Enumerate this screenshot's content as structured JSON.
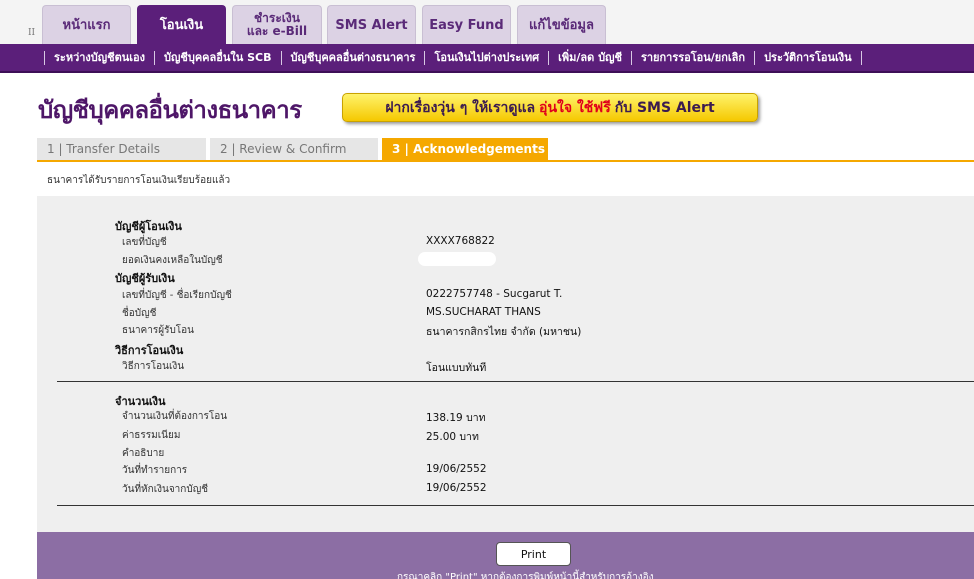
{
  "top_tabs": [
    {
      "label": "หน้าแรก",
      "active": false
    },
    {
      "label": "โอนเงิน",
      "active": true
    },
    {
      "label_line1": "ชำระเงิน",
      "label_line2": "และ e-Bill",
      "active": false
    },
    {
      "label": "SMS Alert",
      "active": false
    },
    {
      "label": "Easy Fund",
      "active": false
    },
    {
      "label": "แก้ไขข้อมูล",
      "active": false
    }
  ],
  "pipe_glyph": "II",
  "subnav": [
    "ระหว่างบัญชีตนเอง",
    "บัญชีบุคคลอื่นใน SCB",
    "บัญชีบุคคลอื่นต่างธนาคาร",
    "โอนเงินไปต่างประเทศ",
    "เพิ่ม/ลด บัญชี",
    "รายการรอโอน/ยกเลิก",
    "ประวัติการโอนเงิน"
  ],
  "page_title": "บัญชีบุคคลอื่นต่างธนาคาร",
  "banner": {
    "part1": "ฝากเรื่องวุ่น ๆ ให้เราดูแล",
    "highlight": "อุ่นใจ ใช้ฟรี",
    "part2": "กับ SMS Alert"
  },
  "steps": [
    "1 | Transfer Details",
    "2 | Review & Confirm",
    "3 | Acknowledgements"
  ],
  "ack_message": "ธนาคารได้รับรายการโอนเงินเรียบร้อยแล้ว",
  "details": {
    "from_header": "บัญชีผู้โอนเงิน",
    "from_account_label": "เลขที่บัญชี",
    "from_account_value": "XXXX768822",
    "balance_label": "ยอดเงินคงเหลือในบัญชี",
    "to_header": "บัญชีผู้รับเงิน",
    "to_account_label": "เลขที่บัญชี - ชื่อเรียกบัญชี",
    "to_account_value": "0222757748 - Sucgarut T.",
    "account_name_label": "ชื่อบัญชี",
    "account_name_value": "MS.SUCHARAT THANS",
    "bank_label": "ธนาคารผู้รับโอน",
    "bank_value": "ธนาคารกสิกรไทย จำกัด (มหาชน)",
    "method_header": "วิธีการโอนเงิน",
    "method_label": "วิธีการโอนเงิน",
    "method_value": "โอนแบบทันที",
    "amount_header": "จำนวนเงิน",
    "amount_label": "จำนวนเงินที่ต้องการโอน",
    "amount_value": "138.19 บาท",
    "fee_label": "ค่าธรรมเนียม",
    "fee_value": "25.00  บาท",
    "desc_label": "คำอธิบาย",
    "txn_date_label": "วันที่ทำรายการ",
    "txn_date_value": "19/06/2552",
    "debit_date_label": "วันที่หักเงินจากบัญชี",
    "debit_date_value": "19/06/2552"
  },
  "print_label": "Print",
  "footer_note": "กรุณาคลิก \"Print\" หากต้องการพิมพ์หน้านี้สำหรับการอ้างอิง",
  "colors": {
    "brand_purple": "#5b1f7a",
    "step_active": "#f5a800",
    "footer": "#8c6ea4"
  }
}
